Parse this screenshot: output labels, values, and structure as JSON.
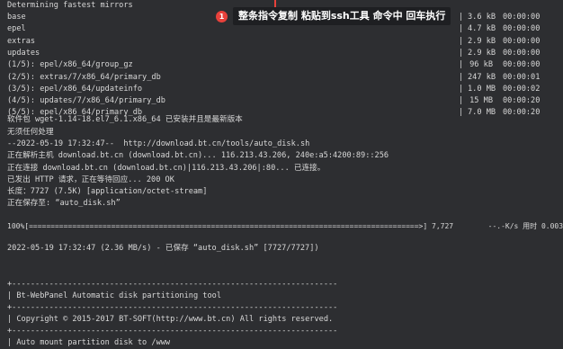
{
  "annotation": {
    "badge_number": "1",
    "text": "整条指令复制 粘贴到ssh工具 命令中 回车执行",
    "badge_color": "#e8413b"
  },
  "terminal": {
    "header": "Determining fastest mirrors",
    "repos": [
      {
        "name": "base",
        "size": "3.6 kB",
        "time": "00:00:00"
      },
      {
        "name": "epel",
        "size": "4.7 kB",
        "time": "00:00:00"
      },
      {
        "name": "extras",
        "size": "2.9 kB",
        "time": "00:00:00"
      },
      {
        "name": "updates",
        "size": "2.9 kB",
        "time": "00:00:00"
      },
      {
        "name": "(1/5): epel/x86_64/group_gz",
        "size": "96 kB",
        "time": "00:00:00"
      },
      {
        "name": "(2/5): extras/7/x86_64/primary_db",
        "size": "247 kB",
        "time": "00:00:01"
      },
      {
        "name": "(3/5): epel/x86_64/updateinfo",
        "size": "1.0 MB",
        "time": "00:00:02"
      },
      {
        "name": "(4/5): updates/7/x86_64/primary_db",
        "size": "15 MB",
        "time": "00:00:20"
      },
      {
        "name": "(5/5): epel/x86_64/primary_db",
        "size": "7.0 MB",
        "time": "00:00:20"
      }
    ],
    "lines_after": [
      "软件包 wget-1.14-18.el7_6.1.x86_64 已安装并且是最新版本",
      "无须任何处理",
      "--2022-05-19 17:32:47--  http://download.bt.cn/tools/auto_disk.sh",
      "正在解析主机 download.bt.cn (download.bt.cn)... 116.213.43.206, 240e:a5:4200:89::256",
      "正在连接 download.bt.cn (download.bt.cn)|116.213.43.206|:80... 已连接。",
      "已发出 HTTP 请求，正在等待回应... 200 OK",
      "长度：7727 (7.5K) [application/octet-stream]",
      "正在保存至: “auto_disk.sh”"
    ],
    "progress_line": "100%[==========================================================================================>] 7,727        --.-K/s 用时 0.003s",
    "saved_line": "2022-05-19 17:32:47 (2.36 MB/s) - 已保存 “auto_disk.sh” [7727/7727])",
    "box_border": "+----------------------------------------------------------------------",
    "box_title": "| Bt-WebPanel Automatic disk partitioning tool",
    "box_copyright": "| Copyright © 2015-2017 BT-SOFT(http://www.bt.cn) All rights reserved.",
    "box_auto": "| Auto mount partition disk to /www"
  }
}
